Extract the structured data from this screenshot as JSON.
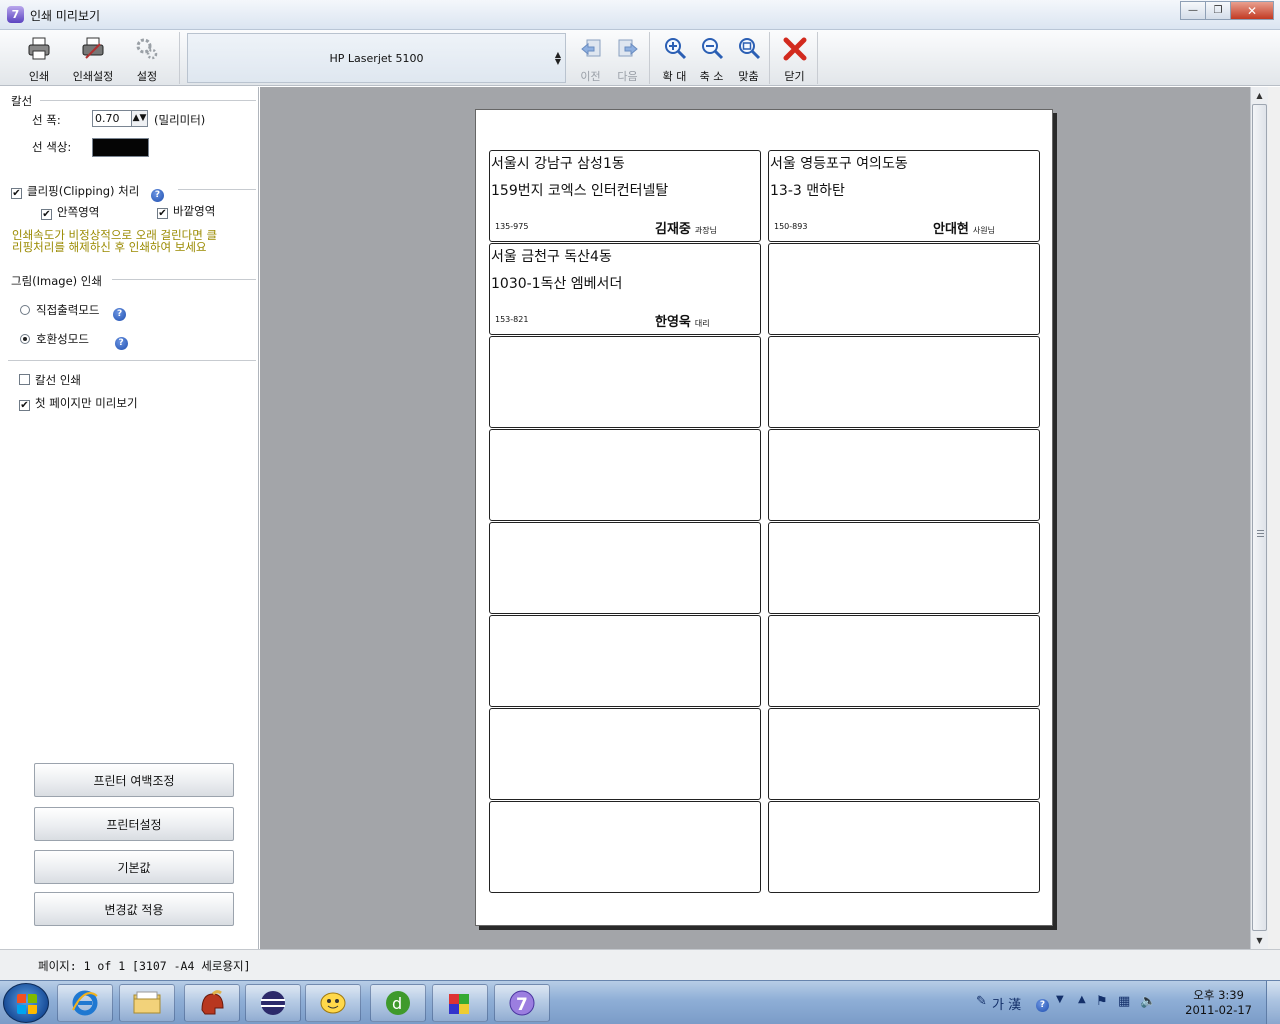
{
  "window": {
    "title": "인쇄 미리보기",
    "app_icon": "7"
  },
  "toolbar": {
    "print": "인쇄",
    "print_setup": "인쇄설정",
    "settings": "설정",
    "printer_name": "HP Laserjet 5100",
    "prev": "이전",
    "next": "다음",
    "zoom_in": "확 대",
    "zoom_out": "축 소",
    "fit": "맞춤",
    "close": "닫기"
  },
  "panel": {
    "line_section": "칼선",
    "line_width_label": "선 폭:",
    "line_width_value": "0.70",
    "line_width_unit": "(밀리미터)",
    "line_color_label": "선 색상:",
    "line_color": "#050505",
    "clipping_label": "클리핑(Clipping) 처리",
    "clipping_checked": true,
    "inner_area": "안쪽영역",
    "inner_checked": true,
    "outer_area": "바깥영역",
    "outer_checked": true,
    "warning_line1": "인쇄속도가 비정상적으로 오래 걸린다면 클",
    "warning_line2": "리핑처리를 해제하신 후 인쇄하여 보세요",
    "image_section": "그림(Image) 인쇄",
    "direct_mode": "직접출력모드",
    "compat_mode": "호환성모드",
    "selected_mode": "compat",
    "print_cutline": "칼선 인쇄",
    "print_cutline_checked": false,
    "first_page_only": "첫 페이지만 미리보기",
    "first_page_only_checked": true,
    "btn_margin": "프린터 여백조정",
    "btn_printer": "프린터설정",
    "btn_default": "기본값",
    "btn_apply": "변경값 적용"
  },
  "labels": [
    {
      "line1": "서울시 강남구 삼성1동",
      "line2": "159번지 코엑스 인터컨터넬탈",
      "zip": "135-975",
      "name": "김재중",
      "title": "과장님"
    },
    {
      "line1": "서울 영등포구 여의도동",
      "line2": "13-3 맨하탄",
      "zip": "150-893",
      "name": "안대현",
      "title": "사원님"
    },
    {
      "line1": "서울 금천구 독산4동",
      "line2": "1030-1독산 엠베서더",
      "zip": "153-821",
      "name": "한영욱",
      "title": "대리"
    }
  ],
  "status": {
    "text": "페이지:  1 of 1  [3107 -A4 세로용지]"
  },
  "taskbar": {
    "ime": "가 漢",
    "time": "오후 3:39",
    "date": "2011-02-17"
  }
}
